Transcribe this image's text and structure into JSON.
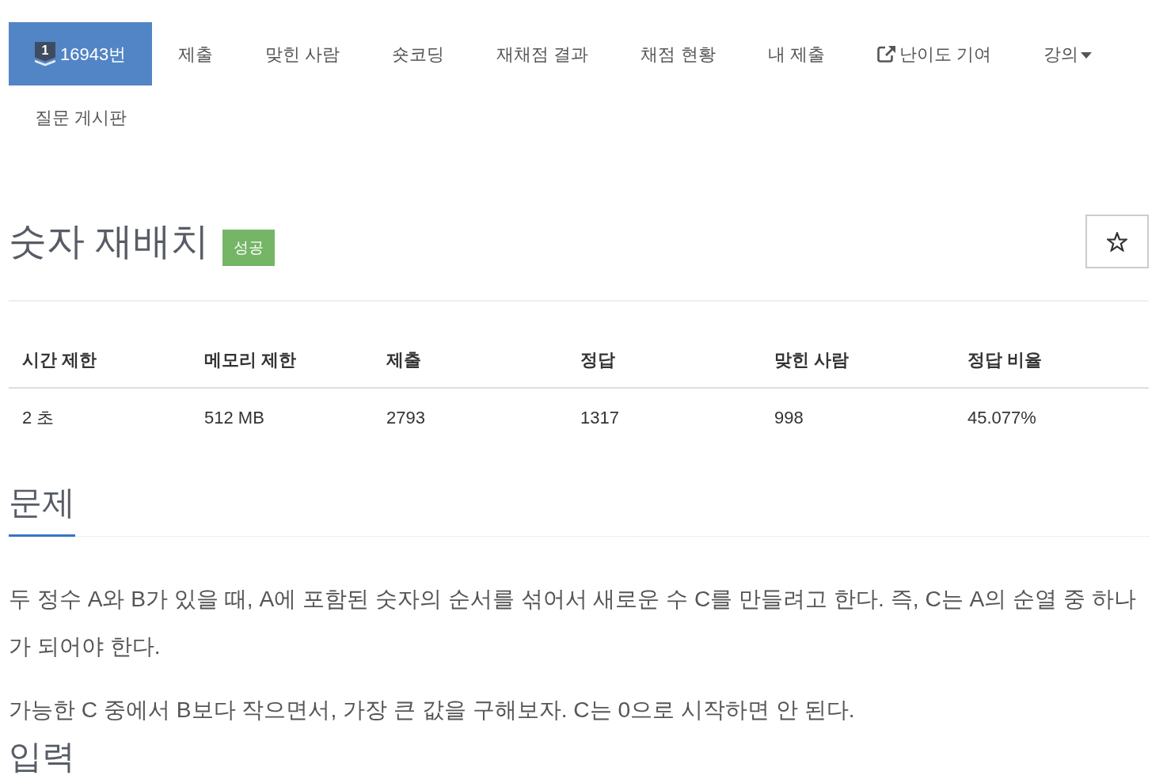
{
  "nav": {
    "items": [
      {
        "label": "16943번",
        "kind": "problem",
        "badge": "1",
        "selected": true
      },
      {
        "label": "제출",
        "kind": "link",
        "selected": false
      },
      {
        "label": "맞힌 사람",
        "kind": "link",
        "selected": false
      },
      {
        "label": "숏코딩",
        "kind": "link",
        "selected": false
      },
      {
        "label": "재채점 결과",
        "kind": "link",
        "selected": false
      },
      {
        "label": "채점 현황",
        "kind": "link",
        "selected": false
      },
      {
        "label": "내 제출",
        "kind": "link",
        "selected": false
      },
      {
        "label": "난이도 기여",
        "kind": "external",
        "selected": false
      },
      {
        "label": "강의",
        "kind": "dropdown",
        "selected": false
      },
      {
        "label": "질문 게시판",
        "kind": "link",
        "selected": false
      }
    ]
  },
  "problem": {
    "title": "숫자 재배치",
    "result_badge": "성공",
    "starred": false
  },
  "info_table": {
    "columns": [
      "시간 제한",
      "메모리 제한",
      "제출",
      "정답",
      "맞힌 사람",
      "정답 비율"
    ],
    "rows": [
      [
        "2 초",
        "512 MB",
        "2793",
        "1317",
        "998",
        "45.077%"
      ]
    ]
  },
  "sections": [
    {
      "heading": "문제",
      "paragraphs": [
        "두 정수 A와 B가 있을 때, A에 포함된 숫자의 순서를 섞어서 새로운 수 C를 만들려고 한다. 즉, C는 A의 순열 중 하나가 되어야 한다.",
        "가능한 C 중에서 B보다 작으면서, 가장 큰 값을 구해보자. C는 0으로 시작하면 안 된다."
      ]
    },
    {
      "heading": "입력"
    }
  ]
}
